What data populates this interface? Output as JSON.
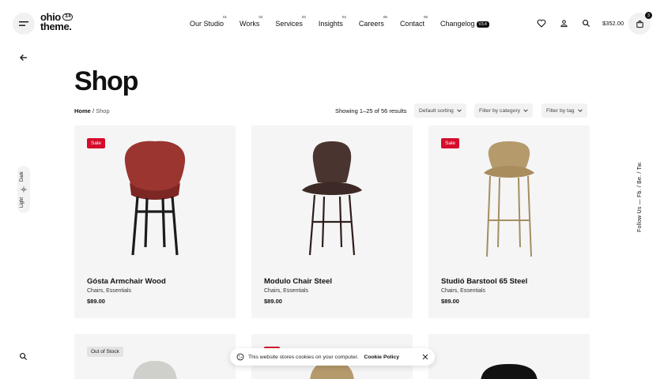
{
  "header": {
    "logo_line1": "ohio",
    "logo_line2": "theme.",
    "logo_version": "3.4",
    "nav": [
      {
        "label": "Our Studio",
        "num": "01"
      },
      {
        "label": "Works",
        "num": "02"
      },
      {
        "label": "Services",
        "num": "03"
      },
      {
        "label": "Insights",
        "num": "04"
      },
      {
        "label": "Careers",
        "num": "05"
      },
      {
        "label": "Contact",
        "num": "06"
      },
      {
        "label": "Changelog",
        "badge": "V3.4"
      }
    ],
    "cart_total": "$352.00",
    "cart_count": "3"
  },
  "left_rail": {
    "theme_light": "Light",
    "theme_dark": "Dark"
  },
  "right_rail": {
    "follow_text": "Follow Us  —  Fb.  /  Be.  /  Tw."
  },
  "page": {
    "title": "Shop",
    "breadcrumb_home": "Home",
    "breadcrumb_sep": "/",
    "breadcrumb_current": "Shop",
    "showing": "Showing 1–25 of 56 results",
    "filters": [
      "Default sorting",
      "Filter by category",
      "Filter by tag"
    ]
  },
  "products": [
    {
      "name": "Gósta Armchair Wood",
      "category": "Chairs, Essentials",
      "price": "$89.00",
      "badge": "Sale",
      "chair_color": "#9b3530",
      "leg_color": "#1c1c1c"
    },
    {
      "name": "Modulo Chair Steel",
      "category": "Chairs, Essentials",
      "price": "$89.00",
      "badge": "",
      "chair_color": "#4a3430",
      "leg_color": "#2f1f1c"
    },
    {
      "name": "Studió Barstool 65 Steel",
      "category": "Chairs, Essentials",
      "price": "$89.00",
      "badge": "Sale",
      "chair_color": "#b59a6b",
      "leg_color": "#a58d62"
    }
  ],
  "products_row2": [
    {
      "badge": "Out of Stock"
    },
    {
      "badge": ""
    },
    {
      "badge": ""
    }
  ],
  "cookie": {
    "text": "This website stores cookies on your computer.",
    "policy": "Cookie Policy"
  },
  "colors": {
    "sale": "#d50c2b",
    "card_bg": "#f5f5f5",
    "text": "#111111"
  }
}
